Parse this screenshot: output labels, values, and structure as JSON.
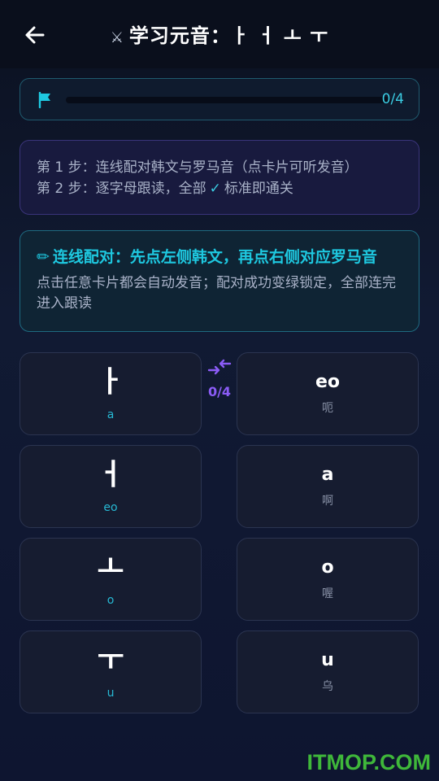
{
  "header": {
    "title_icon": "⚔",
    "title": "学习元音：ㅏ ㅓ ㅗ ㅜ"
  },
  "progress": {
    "label": "0/4",
    "fraction": 0
  },
  "steps": {
    "line1": "第 1 步：连线配对韩文与罗马音（点卡片可听发音）",
    "line2_prefix": "第 2 步：逐字母跟读，全部",
    "line2_check": "✓",
    "line2_suffix": "标准即通关"
  },
  "tip": {
    "icon": "✏",
    "title": "连线配对：先点左侧韩文，再点右侧对应罗马音",
    "body": "点击任意卡片都会自动发音；配对成功变绿锁定，全部连完进入跟读"
  },
  "match": {
    "count": "0/4"
  },
  "left_cards": [
    {
      "hangul": "ㅏ",
      "roman": "a"
    },
    {
      "hangul": "ㅓ",
      "roman": "eo"
    },
    {
      "hangul": "ㅗ",
      "roman": "o"
    },
    {
      "hangul": "ㅜ",
      "roman": "u"
    }
  ],
  "right_cards": [
    {
      "roman": "eo",
      "chinese": "呃"
    },
    {
      "roman": "a",
      "chinese": "啊"
    },
    {
      "roman": "o",
      "chinese": "喔"
    },
    {
      "roman": "u",
      "chinese": "乌"
    }
  ],
  "watermark": "ITMOP.COM",
  "colors": {
    "accent": "#1ec8e0",
    "purple": "#8b5cf6",
    "watermark": "#3fb83a"
  }
}
